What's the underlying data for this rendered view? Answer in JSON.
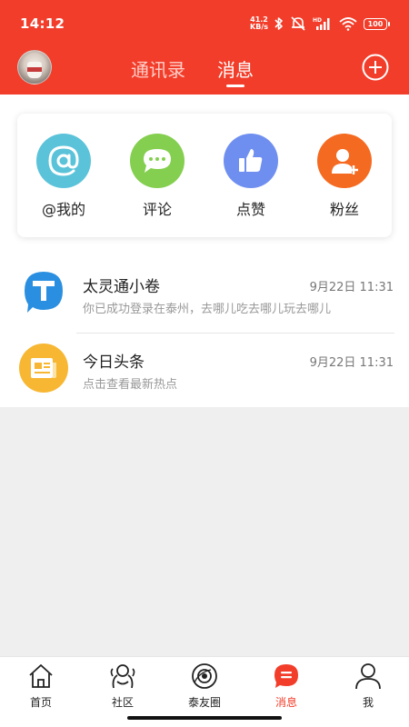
{
  "status_bar": {
    "time": "14:12",
    "net_speed_value": "41.2",
    "net_speed_unit": "KB/s",
    "battery": "100",
    "icons": [
      "bluetooth-icon",
      "mute-icon",
      "hd-signal-icon",
      "wifi-icon",
      "battery-icon"
    ]
  },
  "header": {
    "tabs": [
      {
        "label": "通讯录",
        "active": false
      },
      {
        "label": "消息",
        "active": true
      }
    ],
    "add_icon": "plus-circle-icon",
    "colors": {
      "background": "#f23d2a",
      "inactive_tab": "#ffcfc9",
      "active_tab": "#ffffff"
    }
  },
  "quick_actions": [
    {
      "label": "@我的",
      "icon": "at-icon",
      "color": "#5bc3d9"
    },
    {
      "label": "评论",
      "icon": "chat-bubble-icon",
      "color": "#84cf4f"
    },
    {
      "label": "点赞",
      "icon": "thumbs-up-icon",
      "color": "#6f8ff0"
    },
    {
      "label": "粉丝",
      "icon": "add-user-icon",
      "color": "#f56a21"
    }
  ],
  "messages": [
    {
      "title": "太灵通小卷",
      "time": "9月22日 11:31",
      "preview": "你已成功登录在泰州，去哪儿吃去哪儿玩去哪儿",
      "icon": "t-logo-icon",
      "color": "#2a8fe0"
    },
    {
      "title": "今日头条",
      "time": "9月22日 11:31",
      "preview": "点击查看最新热点",
      "icon": "newspaper-icon",
      "color": "#f7b733"
    }
  ],
  "bottom_nav": [
    {
      "label": "首页",
      "icon": "home-icon",
      "active": false
    },
    {
      "label": "社区",
      "icon": "community-icon",
      "active": false
    },
    {
      "label": "泰友圈",
      "icon": "friends-circle-icon",
      "active": false
    },
    {
      "label": "消息",
      "icon": "message-icon",
      "active": true
    },
    {
      "label": "我",
      "icon": "profile-icon",
      "active": false
    }
  ],
  "accent_color": "#f23d2a"
}
